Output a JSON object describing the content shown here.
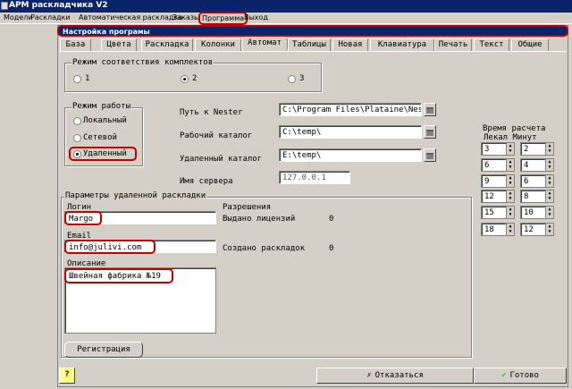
{
  "window": {
    "title": "АРМ раскладчика V2"
  },
  "menu": [
    "Модели",
    "Раскладки",
    "Автоматическая раскладка",
    "Заказы",
    "Программа",
    "Выход"
  ],
  "dialog": {
    "title": "Настройка програмы"
  },
  "tabs": [
    "База",
    "Цвета",
    "Раскладка",
    "Колонки",
    "Автомат",
    "Таблицы",
    "Новая",
    "Клавиатура",
    "Печать",
    "Текст",
    "Общие"
  ],
  "active_tab": "Автомат",
  "kit_mode": {
    "label": "Режим соответствия комплектов",
    "options": [
      "1",
      "2",
      "3"
    ],
    "selected": "2"
  },
  "work_mode": {
    "label": "Режим работы",
    "options": [
      "Локальный",
      "Сетевой",
      "Удаленный"
    ],
    "selected": "Удаленный"
  },
  "paths": {
    "nester_label": "Путь к Nester",
    "nester_value": "C:\\Program Files\\Plataine\\Nester\\",
    "workdir_label": "Рабочий каталог",
    "workdir_value": "C:\\temp\\",
    "remote_label": "Удаленный каталог",
    "remote_value": "E:\\temp\\",
    "server_label": "Имя сервера",
    "server_value": "127.0.0.1"
  },
  "calc_time": {
    "title_line1": "Время расчета",
    "title_line2": "Лекал Минут",
    "rows": [
      [
        "3",
        "2"
      ],
      [
        "6",
        "4"
      ],
      [
        "9",
        "6"
      ],
      [
        "12",
        "8"
      ],
      [
        "15",
        "10"
      ],
      [
        "18",
        "12"
      ]
    ]
  },
  "remote": {
    "group_label": "Параметры удаленной раскладки",
    "login_label": "Логин",
    "login_value": "Margo",
    "email_label": "Email",
    "email_value": "info@julivi.com",
    "description_label": "Описание",
    "description_value": "Швейная фабрика №19",
    "permissions_label": "Разрешения",
    "licenses_label": "Выдано лицензий",
    "licenses_value": "0",
    "created_label": "Создано раскладок",
    "created_value": "0",
    "register_label": "Регистрация"
  },
  "footer": {
    "help_label": "?",
    "cancel_label": "Отказаться",
    "ok_label": "Готово"
  }
}
